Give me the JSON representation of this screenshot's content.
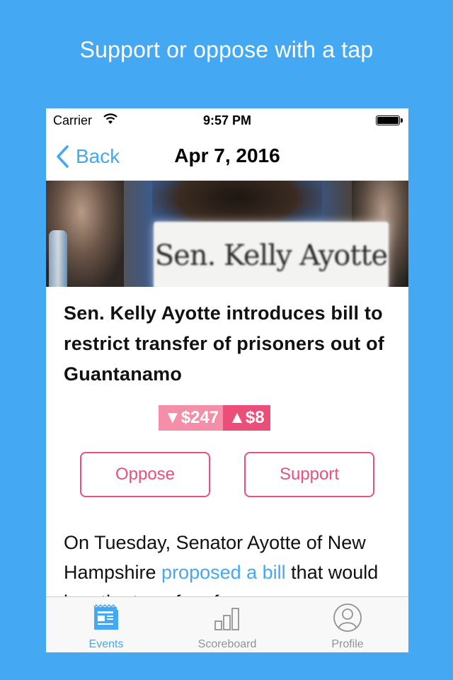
{
  "headline": "Support or oppose with a tap",
  "status_bar": {
    "carrier": "Carrier",
    "time": "9:57 PM"
  },
  "nav": {
    "back_label": "Back",
    "title": "Apr 7, 2016"
  },
  "hero": {
    "nameplate_text": "Sen. Kelly Ayotte"
  },
  "article": {
    "title": "Sen. Kelly Ayotte introduces bill to restrict transfer of prisoners out of Guantanamo",
    "oppose_amount": "▼$247",
    "support_amount": "▲$8",
    "oppose_button": "Oppose",
    "support_button": "Support",
    "body_intro": "On Tuesday, Senator Ayotte of New Hampshire ",
    "body_link": "proposed a bill",
    "body_after_link": " that would",
    "body_cut": "ban the transfer of"
  },
  "tabs": [
    {
      "label": "Events",
      "icon": "events-icon",
      "active": true
    },
    {
      "label": "Scoreboard",
      "icon": "scoreboard-icon",
      "active": false
    },
    {
      "label": "Profile",
      "icon": "profile-icon",
      "active": false
    }
  ],
  "colors": {
    "background": "#44a8f2",
    "accent": "#44a8f2",
    "pink": "#e8507d",
    "pink_light": "#f58fa9"
  }
}
